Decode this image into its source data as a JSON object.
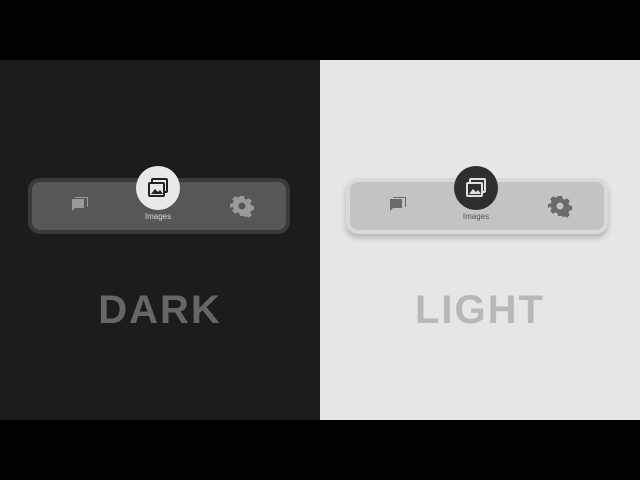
{
  "dark_panel": {
    "nav": {
      "items": [
        {
          "icon": "chat-icon"
        },
        {
          "icon": "images-icon",
          "label": "Images",
          "active": true
        },
        {
          "icon": "gear-icon"
        }
      ]
    },
    "caption": "DARK"
  },
  "light_panel": {
    "nav": {
      "items": [
        {
          "icon": "chat-icon"
        },
        {
          "icon": "images-icon",
          "label": "Images",
          "active": true
        },
        {
          "icon": "gear-icon"
        }
      ]
    },
    "caption": "LIGHT"
  },
  "colors": {
    "dark_bg": "#1c1c1c",
    "light_bg": "#e6e6e6",
    "dark_bar": "#575757",
    "light_bar": "#c3c3c3"
  }
}
